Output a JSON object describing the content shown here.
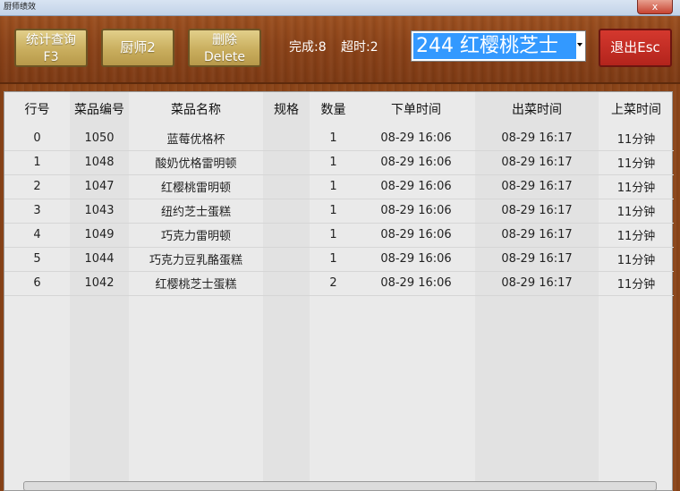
{
  "window": {
    "title": "厨师绩效",
    "close_label": "x"
  },
  "toolbar": {
    "stats_label_line1": "统计查询",
    "stats_label_line2": "F3",
    "chef_label": "厨师2",
    "delete_label_line1": "删除",
    "delete_label_line2": "Delete",
    "done_text": "完成:8",
    "overtime_text": "超时:2",
    "dish_select_value": "244    红樱桃芝士",
    "exit_label": "退出Esc"
  },
  "grid": {
    "columns": [
      "行号",
      "菜品编号",
      "菜品名称",
      "规格",
      "数量",
      "下单时间",
      "出菜时间",
      "上菜时间"
    ],
    "rows": [
      {
        "row_no": "0",
        "dish_code": "1050",
        "dish_name": "蓝莓优格杯",
        "spec": "",
        "qty": "1",
        "order_time": "08-29 16:06",
        "out_time": "08-29 16:17",
        "serve_time": "11分钟",
        "late": false
      },
      {
        "row_no": "1",
        "dish_code": "1048",
        "dish_name": "酸奶优格雷明顿",
        "spec": "",
        "qty": "1",
        "order_time": "08-29 16:06",
        "out_time": "08-29 16:17",
        "serve_time": "11分钟",
        "late": false
      },
      {
        "row_no": "2",
        "dish_code": "1047",
        "dish_name": "红樱桃雷明顿",
        "spec": "",
        "qty": "1",
        "order_time": "08-29 16:06",
        "out_time": "08-29 16:17",
        "serve_time": "11分钟",
        "late": false
      },
      {
        "row_no": "3",
        "dish_code": "1043",
        "dish_name": "纽约芝士蛋糕",
        "spec": "",
        "qty": "1",
        "order_time": "08-29 16:06",
        "out_time": "08-29 16:17",
        "serve_time": "11分钟",
        "late": false
      },
      {
        "row_no": "4",
        "dish_code": "1049",
        "dish_name": "巧克力雷明顿",
        "spec": "",
        "qty": "1",
        "order_time": "08-29 16:06",
        "out_time": "08-29 16:17",
        "serve_time": "11分钟",
        "late": false
      },
      {
        "row_no": "5",
        "dish_code": "1044",
        "dish_name": "巧克力豆乳酪蛋糕",
        "spec": "",
        "qty": "1",
        "order_time": "08-29 16:06",
        "out_time": "08-29 16:17",
        "serve_time": "11分钟",
        "late": false
      },
      {
        "row_no": "6",
        "dish_code": "1042",
        "dish_name": "红樱桃芝士蛋糕",
        "spec": "",
        "qty": "2",
        "order_time": "08-29 16:06",
        "out_time": "08-29 16:17",
        "serve_time": "11分钟",
        "late": true
      }
    ]
  },
  "colors": {
    "wood": "#8a4418",
    "gold_button": "#c9ae5e",
    "exit_button": "#c22d23",
    "selection": "#3399ff",
    "late_text": "#e01010"
  }
}
